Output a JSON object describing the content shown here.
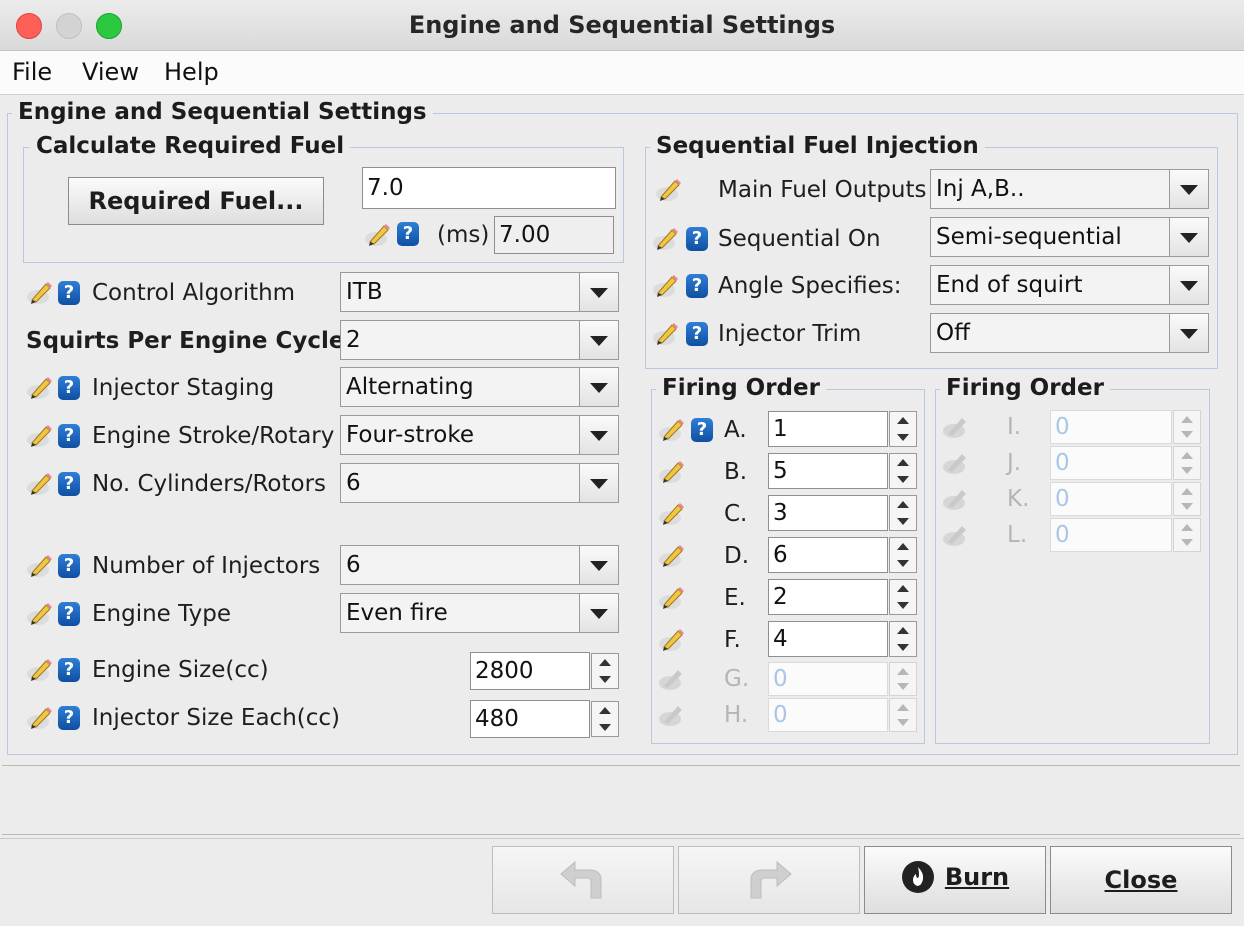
{
  "window": {
    "title": "Engine and Sequential Settings"
  },
  "menu": {
    "file": "File",
    "view": "View",
    "help": "Help"
  },
  "main_group": {
    "legend": "Engine and Sequential Settings"
  },
  "req_fuel": {
    "legend": "Calculate Required Fuel",
    "button": "Required Fuel...",
    "value": "7.0",
    "unit": "(ms)",
    "computed": "7.00"
  },
  "left": {
    "control_algorithm": {
      "label": "Control Algorithm",
      "value": "ITB"
    },
    "squirts": {
      "label": "Squirts Per Engine Cycle",
      "value": "2"
    },
    "injector_staging": {
      "label": "Injector Staging",
      "value": "Alternating"
    },
    "engine_stroke": {
      "label": "Engine Stroke/Rotary",
      "value": "Four-stroke"
    },
    "cylinders": {
      "label": "No. Cylinders/Rotors",
      "value": "6"
    },
    "injectors": {
      "label": "Number of Injectors",
      "value": "6"
    },
    "engine_type": {
      "label": "Engine Type",
      "value": "Even fire"
    },
    "engine_size": {
      "label": "Engine Size(cc)",
      "value": "2800"
    },
    "injector_size": {
      "label": "Injector Size Each(cc)",
      "value": "480"
    }
  },
  "sequential": {
    "legend": "Sequential Fuel Injection",
    "main_outputs": {
      "label": "Main Fuel Outputs",
      "value": "Inj A,B.."
    },
    "sequential_on": {
      "label": "Sequential On",
      "value": "Semi-sequential"
    },
    "angle_specifies": {
      "label": "Angle Specifies:",
      "value": "End of squirt"
    },
    "injector_trim": {
      "label": "Injector Trim",
      "value": "Off"
    }
  },
  "firing1": {
    "legend": "Firing Order",
    "rows": [
      {
        "label": "A.",
        "value": "1"
      },
      {
        "label": "B.",
        "value": "5"
      },
      {
        "label": "C.",
        "value": "3"
      },
      {
        "label": "D.",
        "value": "6"
      },
      {
        "label": "E.",
        "value": "2"
      },
      {
        "label": "F.",
        "value": "4"
      },
      {
        "label": "G.",
        "value": "0"
      },
      {
        "label": "H.",
        "value": "0"
      }
    ]
  },
  "firing2": {
    "legend": "Firing Order",
    "rows": [
      {
        "label": "I.",
        "value": "0"
      },
      {
        "label": "J.",
        "value": "0"
      },
      {
        "label": "K.",
        "value": "0"
      },
      {
        "label": "L.",
        "value": "0"
      }
    ]
  },
  "buttons": {
    "burn": "Burn",
    "close": "Close"
  },
  "colors": {
    "accent_help": "#1a5fb4",
    "disabled_text": "#aac6e6",
    "traffic_red": "#fe5f57",
    "traffic_gray": "#d3d3d3",
    "traffic_green": "#2bc840"
  },
  "icons": {
    "help": "question-icon",
    "edit": "pencil-icon",
    "burn": "flame-icon",
    "undo": "undo-arrow-icon",
    "redo": "redo-arrow-icon"
  }
}
